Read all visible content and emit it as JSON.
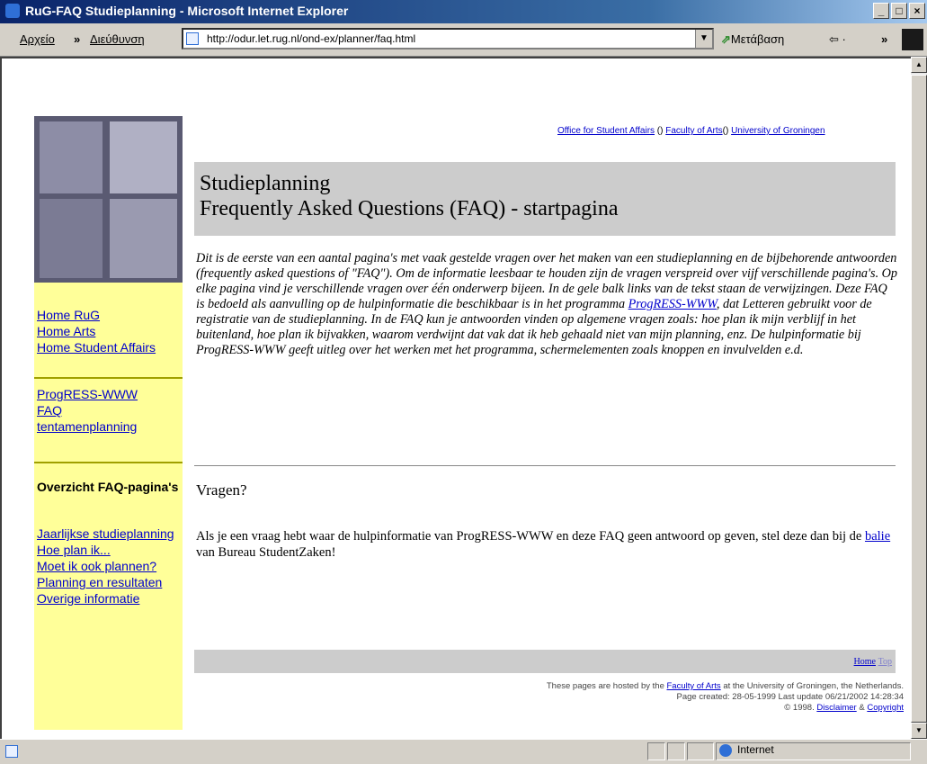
{
  "window": {
    "title": "RuG-FAQ Studieplanning - Microsoft Internet Explorer",
    "buttons": [
      "_",
      "□",
      "×"
    ]
  },
  "toolbar": {
    "archive_label": "Αρχείο",
    "chevron": "»",
    "address_label": "Διεύθυνση",
    "url": "http://odur.let.rug.nl/ond-ex/planner/faq.html",
    "go_label": "Μετάβαση",
    "links_label": "⇦ ·",
    "chevron2": "»"
  },
  "sidebar": {
    "group1": [
      "Home RuG",
      "Home Arts",
      "Home Student Affairs"
    ],
    "group2": [
      "ProgRESS-WWW",
      "FAQ",
      "tentamenplanning"
    ],
    "overview_title": "Overzicht FAQ-pagina's",
    "group3": [
      "Jaarlijkse studieplanning",
      "Hoe plan ik...",
      "Moet ik ook plannen?",
      "Planning en resultaten",
      "Overige informatie"
    ]
  },
  "topnav": {
    "link1": "Office for Student Affairs",
    "sep1": " () ",
    "link2": "Faculty of Arts",
    "sep2": "() ",
    "link3": "University of Groningen"
  },
  "heading": {
    "line1": "Studieplanning",
    "line2": "Frequently Asked Questions (FAQ) - startpagina"
  },
  "intro": {
    "part1": "Dit is de eerste van een aantal pagina's met vaak gestelde vragen over het maken van een studieplanning en de bijbehorende antwoorden (frequently asked questions of \"FAQ\"). Om de informatie leesbaar te houden zijn de vragen verspreid over vijf verschillende pagina's. Op elke pagina vind je verschillende vragen over één onderwerp bijeen. In de gele balk links van de tekst staan de verwijzingen. Deze FAQ is bedoeld als aanvulling op de hulpinformatie die beschikbaar is in het programma ",
    "link": "ProgRESS-WWW",
    "part2": ", dat Letteren gebruikt voor de registratie van de studieplanning. In de FAQ kun je antwoorden vinden op algemene vragen zoals: hoe plan ik mijn verblijf in het buitenland, hoe plan ik bijvakken, waarom verdwijnt dat vak dat ik heb gehaald niet van mijn planning, enz. De hulpinformatie bij ProgRESS-WWW geeft uitleg over het werken met het programma, schermelementen zoals knoppen en invulvelden e.d."
  },
  "questions": {
    "title": "Vragen?",
    "part1": "Als je een vraag hebt waar de hulpinformatie van ProgRESS-WWW en deze FAQ geen antwoord op geven, stel deze dan bij de ",
    "link": "balie",
    "part2": " van Bureau StudentZaken!"
  },
  "bottombar": {
    "home": "Home",
    "top": "Top"
  },
  "footer": {
    "line1_a": "These pages are hosted by the ",
    "line1_link": "Faculty of Arts",
    "line1_b": " at the University of Groningen, the Netherlands.",
    "line2": "Page created: 28-05-1999 Last update 06/21/2002 14:28:34",
    "line3_a": "© 1998. ",
    "line3_link1": "Disclaimer",
    "line3_sep": " & ",
    "line3_link2": "Copyright"
  },
  "statusbar": {
    "zone": "Internet"
  }
}
